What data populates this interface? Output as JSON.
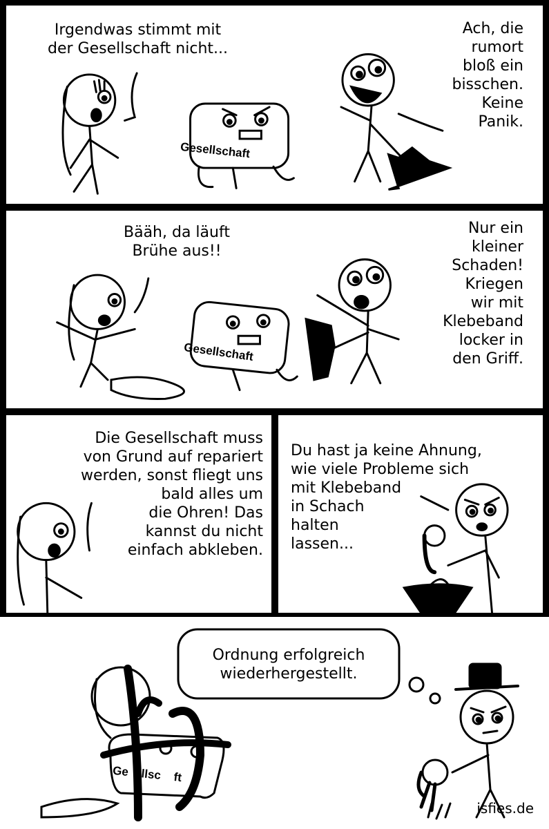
{
  "comic": {
    "label_box": "Gesellschaft",
    "label_box_partial": "Ge    llsc    ft",
    "p1": {
      "left": "Irgendwas stimmt mit\nder Gesellschaft nicht...",
      "right": "Ach, die\nrumort\nbloß ein\nbisschen.\nKeine\nPanik."
    },
    "p2": {
      "left": "Bääh, da läuft\nBrühe aus!!",
      "right": "Nur ein\nkleiner\nSchaden!\nKriegen\nwir mit\nKlebeband\nlocker in\nden Griff."
    },
    "p3": {
      "text": "Die Gesellschaft muss\nvon Grund auf repariert\nwerden, sonst fliegt uns\nbald alles um\ndie Ohren! Das\nkannst du nicht\neinfach abkleben."
    },
    "p4": {
      "text": "Du hast ja keine Ahnung,\nwie viele Probleme sich\nmit Klebeband\nin Schach\nhalten\nlassen..."
    },
    "p5": {
      "thought": "Ordnung erfolgreich\nwiederhergestellt."
    },
    "credit": "isfies.de"
  }
}
